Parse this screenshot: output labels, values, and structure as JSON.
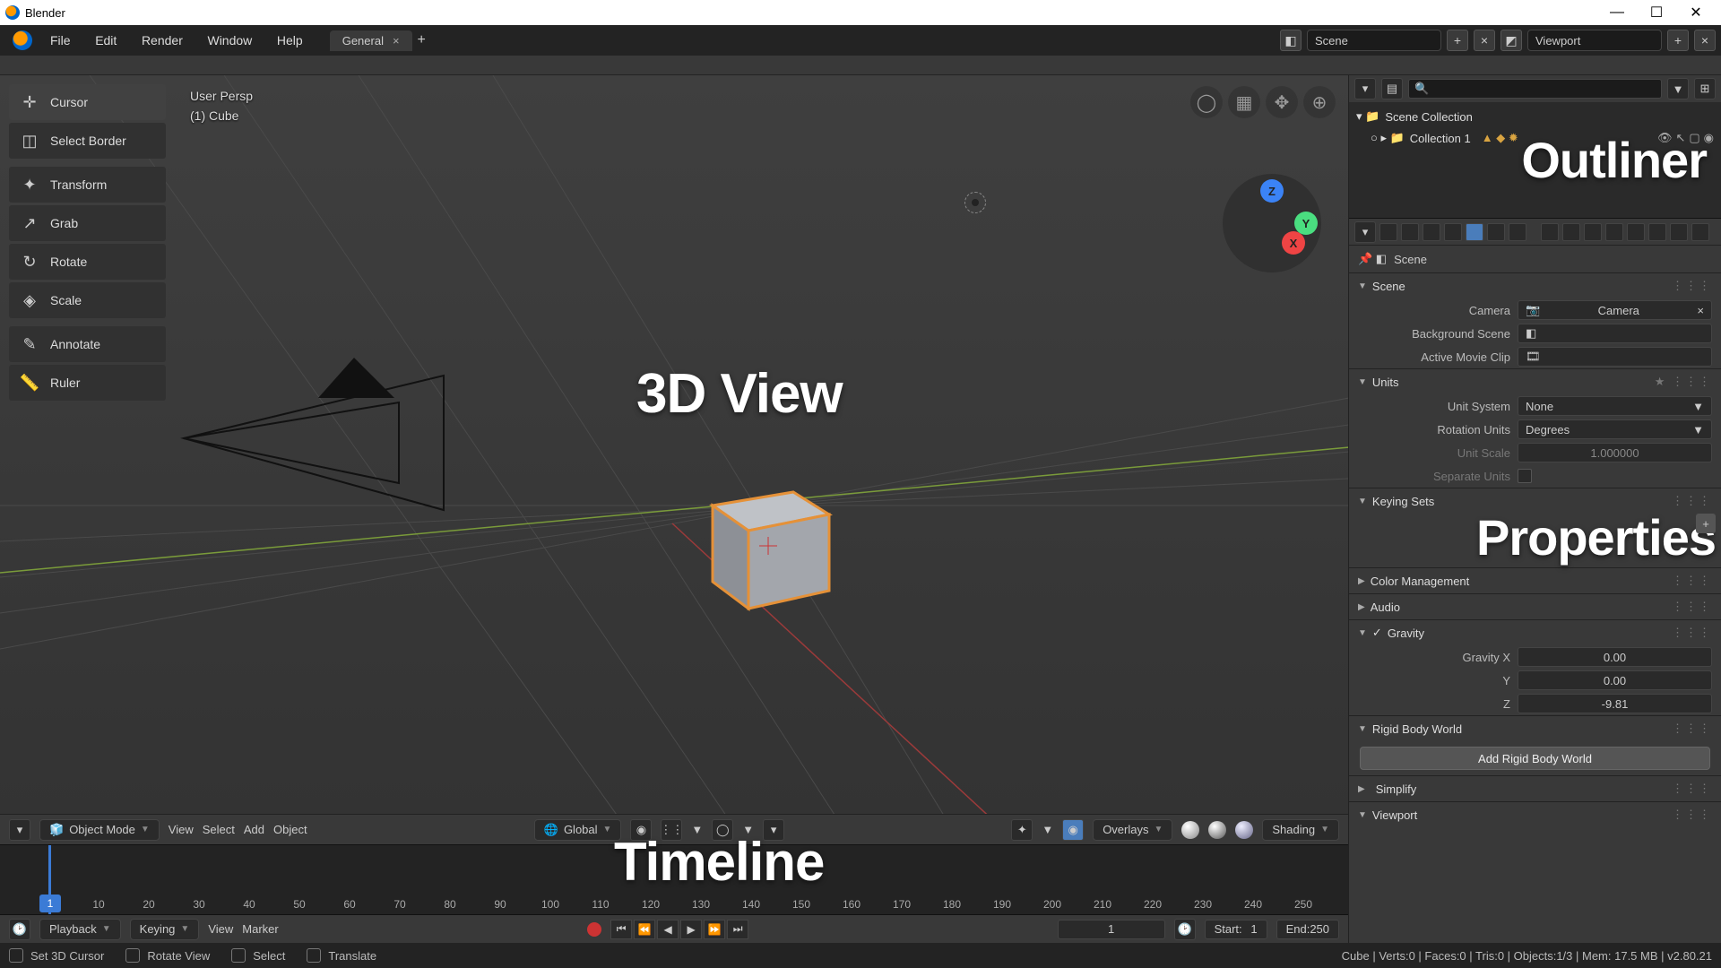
{
  "titlebar": {
    "app": "Blender"
  },
  "menubar": {
    "items": [
      "File",
      "Edit",
      "Render",
      "Window",
      "Help"
    ]
  },
  "workspace": {
    "active": "General"
  },
  "scene_selector": {
    "label": "Scene"
  },
  "layer_selector": {
    "label": "Viewport"
  },
  "annotations": {
    "view3d": "3D View",
    "timeline": "Timeline",
    "outliner": "Outliner",
    "properties": "Properties"
  },
  "hud": {
    "persp": "User Persp",
    "object": "(1) Cube"
  },
  "toolshelf": [
    {
      "name": "cursor",
      "label": "Cursor",
      "icon": "✛"
    },
    {
      "name": "select-border",
      "label": "Select Border",
      "icon": "◫"
    },
    {
      "name": "transform",
      "label": "Transform",
      "icon": "✦"
    },
    {
      "name": "grab",
      "label": "Grab",
      "icon": "↗"
    },
    {
      "name": "rotate",
      "label": "Rotate",
      "icon": "↻"
    },
    {
      "name": "scale",
      "label": "Scale",
      "icon": "◈"
    },
    {
      "name": "annotate",
      "label": "Annotate",
      "icon": "✎"
    },
    {
      "name": "ruler",
      "label": "Ruler",
      "icon": "📏"
    }
  ],
  "view3d_header": {
    "mode": "Object Mode",
    "menus": [
      "View",
      "Select",
      "Add",
      "Object"
    ],
    "orientation": "Global",
    "overlays": "Overlays",
    "shading": "Shading"
  },
  "timeline": {
    "ticks": [
      "10",
      "20",
      "30",
      "40",
      "50",
      "60",
      "70",
      "80",
      "90",
      "100",
      "110",
      "120",
      "130",
      "140",
      "150",
      "160",
      "170",
      "180",
      "190",
      "200",
      "210",
      "220",
      "230",
      "240",
      "250"
    ],
    "menus": [
      "Playback",
      "Keying",
      "View",
      "Marker"
    ],
    "current": "1",
    "start_label": "Start:",
    "start": "1",
    "end_label": "End:",
    "end": "250",
    "head": "1"
  },
  "outliner": {
    "root": "Scene Collection",
    "collection": "Collection 1"
  },
  "properties": {
    "crumb": "Scene",
    "scene_panel": "Scene",
    "camera_label": "Camera",
    "camera_val": "Camera",
    "bg_label": "Background Scene",
    "clip_label": "Active Movie Clip",
    "units_panel": "Units",
    "unit_system_label": "Unit System",
    "unit_system_val": "None",
    "rot_label": "Rotation Units",
    "rot_val": "Degrees",
    "scale_label": "Unit Scale",
    "scale_val": "1.000000",
    "sep_label": "Separate Units",
    "keying_panel": "Keying Sets",
    "color_panel": "Color Management",
    "audio_panel": "Audio",
    "gravity_panel": "Gravity",
    "gx_label": "Gravity X",
    "gx": "0.00",
    "gy_label": "Y",
    "gy": "0.00",
    "gz_label": "Z",
    "gz": "-9.81",
    "rigid_panel": "Rigid Body World",
    "rigid_btn": "Add Rigid Body World",
    "simplify_panel": "Simplify",
    "viewport_panel": "Viewport"
  },
  "statusbar": {
    "cursor": "Set 3D Cursor",
    "rotate": "Rotate View",
    "select": "Select",
    "translate": "Translate",
    "info": "Cube | Verts:0 | Faces:0 | Tris:0 | Objects:1/3 | Mem: 17.5 MB | v2.80.21"
  }
}
